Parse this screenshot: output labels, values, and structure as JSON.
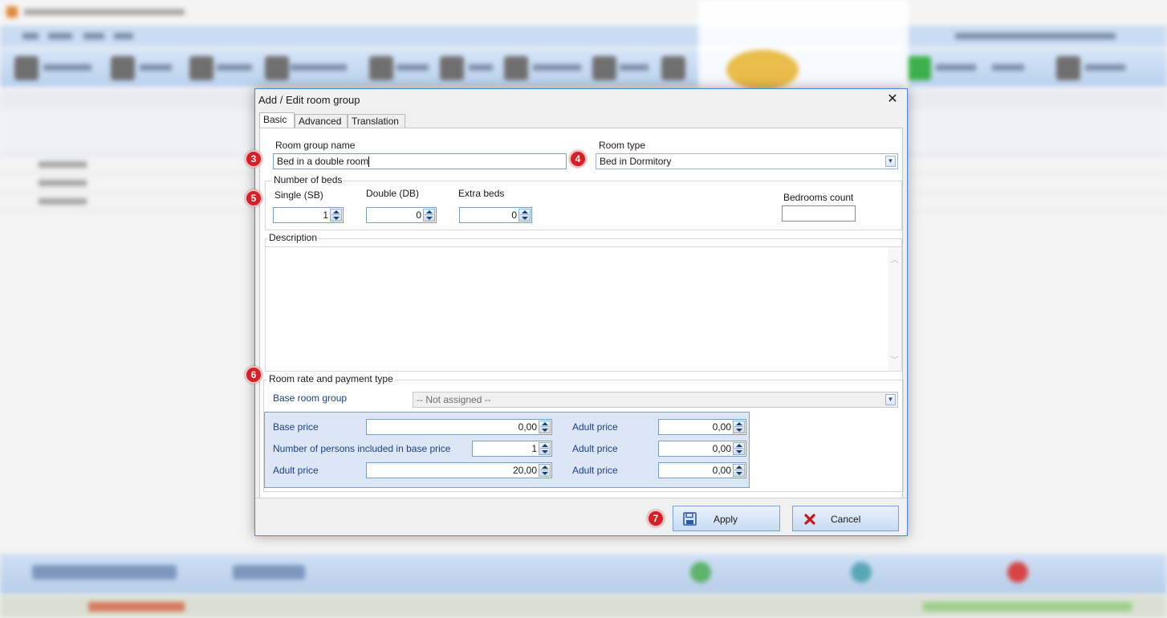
{
  "dialog": {
    "title": "Add / Edit room group",
    "close_glyph": "✕",
    "tabs": [
      {
        "label": "Basic",
        "active": true
      },
      {
        "label": "Advanced",
        "active": false
      },
      {
        "label": "Translation",
        "active": false
      }
    ]
  },
  "basic": {
    "room_group_name": {
      "label": "Room group name",
      "value": "Bed in a double room"
    },
    "room_type": {
      "label": "Room type",
      "value": "Bed in Dormitory"
    },
    "beds": {
      "group_label": "Number of beds",
      "single": {
        "label": "Single (SB)",
        "value": "1"
      },
      "double": {
        "label": "Double (DB)",
        "value": "0"
      },
      "extra": {
        "label": "Extra beds",
        "value": "0"
      },
      "bedrooms": {
        "label": "Bedrooms count",
        "value": ""
      }
    },
    "description": {
      "label": "Description",
      "value": "",
      "scroll_up": "︿",
      "scroll_down": "﹀"
    },
    "rate": {
      "group_label": "Room rate and payment type",
      "base_room_group": {
        "label": "Base room group",
        "value": "-- Not assigned --"
      },
      "base_price": {
        "label": "Base price",
        "value": "0,00"
      },
      "persons_included": {
        "label": "Number of persons included in base price",
        "value": "1"
      },
      "adult_price_left": {
        "label": "Adult price",
        "value": "20,00"
      },
      "adult_prices_right": [
        {
          "label": "Adult price",
          "value": "0,00"
        },
        {
          "label": "Adult price",
          "value": "0,00"
        },
        {
          "label": "Adult price",
          "value": "0,00"
        }
      ]
    }
  },
  "buttons": {
    "apply": "Apply",
    "cancel": "Cancel"
  },
  "markers": [
    "3",
    "4",
    "5",
    "6",
    "7"
  ],
  "colors": {
    "dialog_border": "#4a88d0",
    "marker_red": "#d81f26",
    "label_blue": "#1c3f86",
    "price_panel": "#dce6f4",
    "cancel_icon": "#c4161c"
  },
  "icons": {
    "apply": "floppy-disk-icon",
    "cancel": "red-x-icon",
    "dropdown": "chevron-down-icon"
  }
}
